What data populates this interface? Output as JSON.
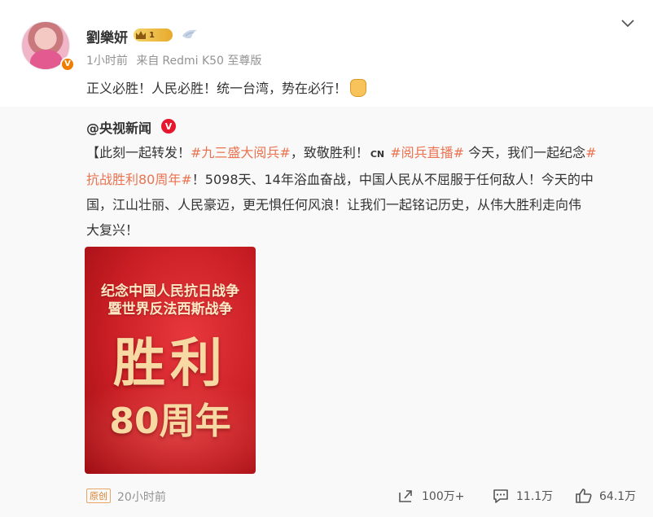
{
  "post": {
    "author": "劉樂妍",
    "vip_level": "1",
    "time": "1小时前",
    "source_prefix": "来自",
    "source_device": "Redmi K50 至尊版",
    "text": "正义必胜！人民必胜！统一台湾，势在必行！"
  },
  "retweet": {
    "author": "@央视新闻",
    "lines": [
      [
        {
          "t": "【此刻一起转发！",
          "tag": false
        },
        {
          "t": "#九三盛大阅兵#",
          "tag": true
        },
        {
          "t": "，致敬胜利！",
          "tag": false
        },
        {
          "t": "CN",
          "tag": false,
          "cn": true
        },
        {
          "t": " ",
          "tag": false
        },
        {
          "t": "#阅兵直播#",
          "tag": true
        },
        {
          "t": " 今天，我们一起纪念",
          "tag": false
        },
        {
          "t": "#",
          "tag": true
        }
      ],
      [
        {
          "t": "抗战胜利80周年#",
          "tag": true
        },
        {
          "t": "！5098天、14年浴血奋战，中国人民从不屈服于任何敌人！今天的中",
          "tag": false
        }
      ],
      [
        {
          "t": "国，江山壮丽、人民豪迈，更无惧任何风浪！让我们一起铭记历史，从伟大胜利走向伟",
          "tag": false
        }
      ],
      [
        {
          "t": "大复兴！",
          "tag": false
        }
      ]
    ],
    "poster": {
      "line1": "纪念中国人民抗日战争",
      "line2": "暨世界反法西斯战争",
      "big": "胜利",
      "anniversary": "80周年"
    },
    "original_tag": "原创",
    "time": "20小时前",
    "reposts": "100万+",
    "comments": "11.1万",
    "likes": "64.1万"
  },
  "icons": {
    "verify_badge": "verified-v-icon",
    "more": "chevron-down-icon",
    "repost": "repost-icon",
    "comment": "comment-icon",
    "like": "thumbs-up-icon"
  },
  "colors": {
    "hashtag": "#eb7350",
    "muted": "#939393",
    "retweet_bg": "#f9f9f9"
  }
}
